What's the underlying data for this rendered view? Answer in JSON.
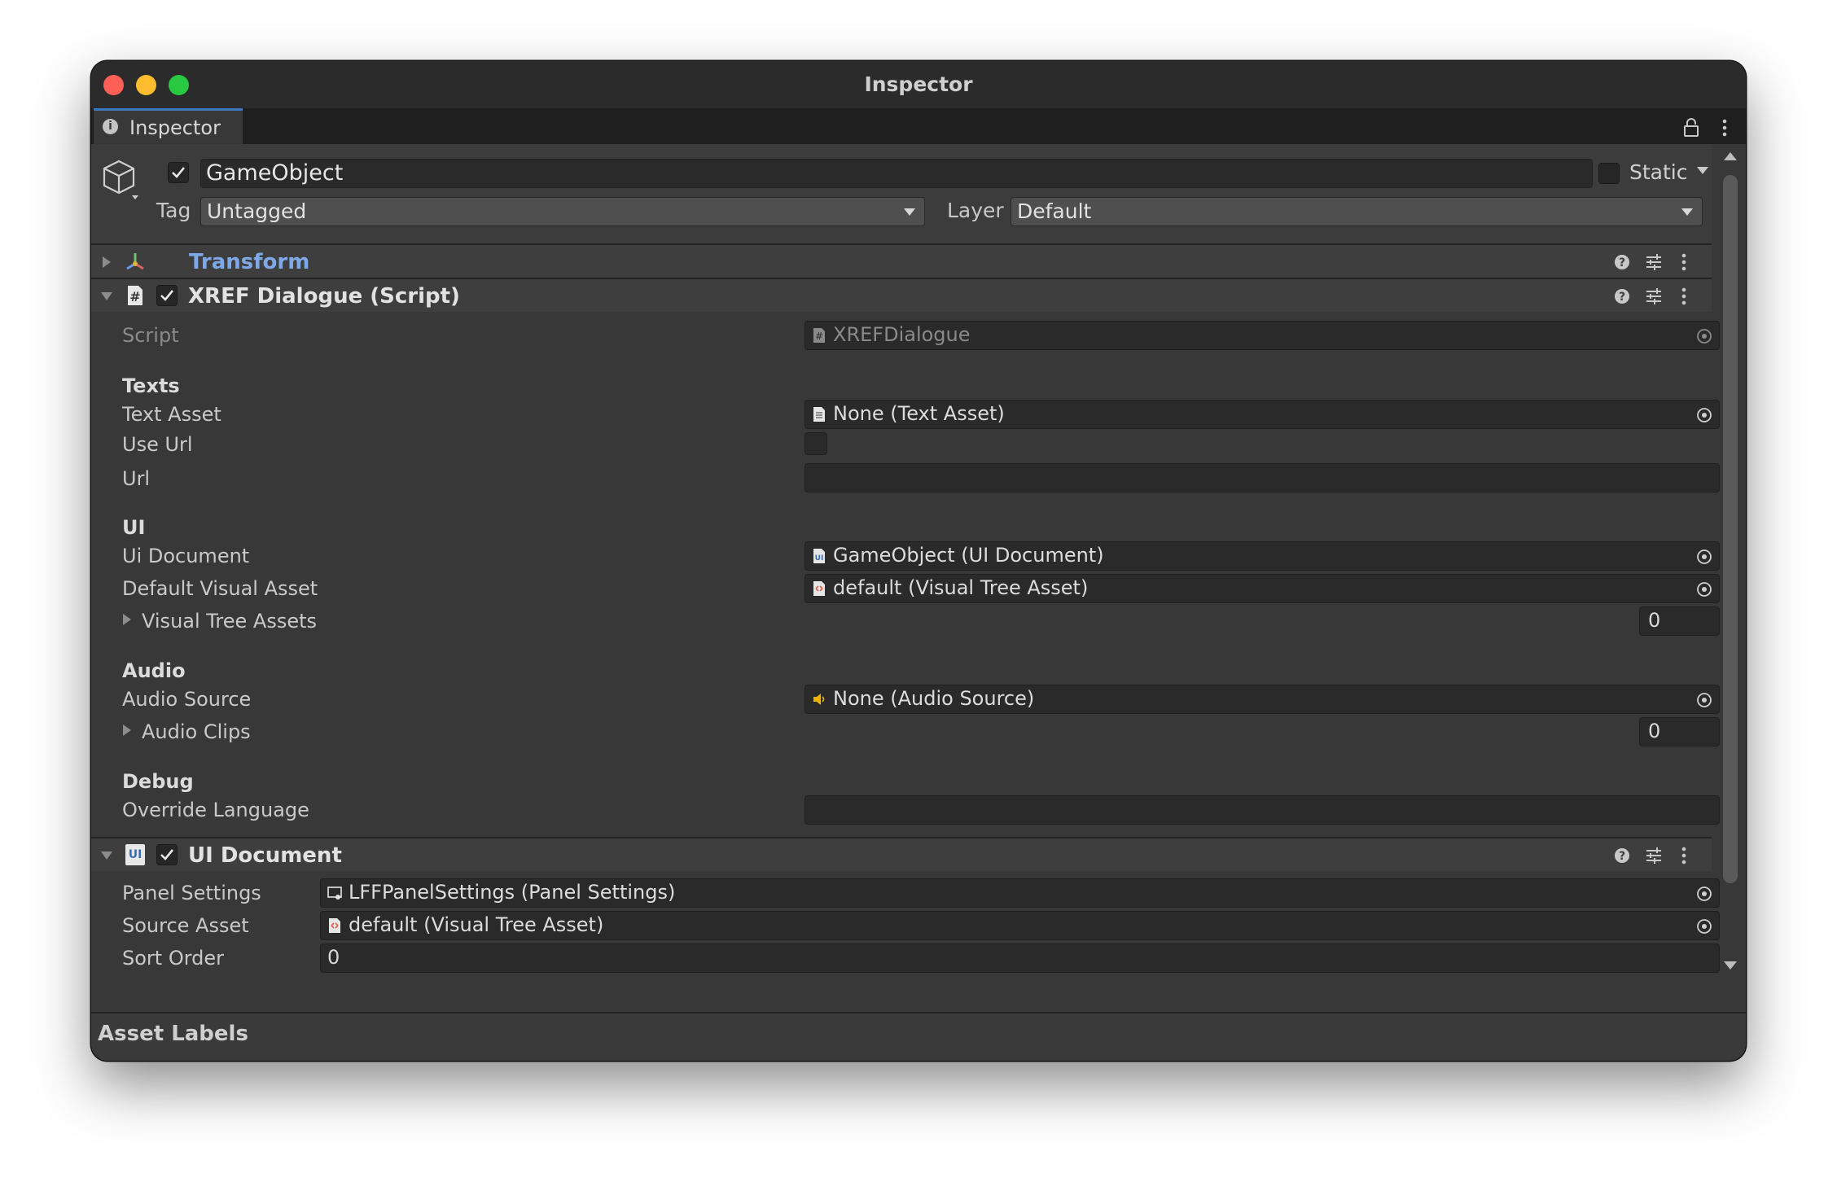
{
  "window": {
    "title": "Inspector"
  },
  "tab": {
    "label": "Inspector"
  },
  "gameobject": {
    "name": "GameObject",
    "static_label": "Static",
    "tag_label": "Tag",
    "tag_value": "Untagged",
    "layer_label": "Layer",
    "layer_value": "Default"
  },
  "transform": {
    "title": "Transform"
  },
  "xref": {
    "title": "XREF Dialogue (Script)",
    "script_label": "Script",
    "script_value": "XREFDialogue",
    "texts_header": "Texts",
    "text_asset_label": "Text Asset",
    "text_asset_value": "None (Text Asset)",
    "use_url_label": "Use Url",
    "url_label": "Url",
    "url_value": "",
    "ui_header": "UI",
    "ui_document_label": "Ui Document",
    "ui_document_value": "GameObject (UI Document)",
    "default_visual_label": "Default Visual Asset",
    "default_visual_value": "default (Visual Tree Asset)",
    "visual_tree_label": "Visual Tree Assets",
    "visual_tree_count": "0",
    "audio_header": "Audio",
    "audio_source_label": "Audio Source",
    "audio_source_value": "None (Audio Source)",
    "audio_clips_label": "Audio Clips",
    "audio_clips_count": "0",
    "debug_header": "Debug",
    "override_language_label": "Override Language",
    "override_language_value": ""
  },
  "ui_document": {
    "title": "UI Document",
    "icon_text": "UI",
    "panel_settings_label": "Panel Settings",
    "panel_settings_value": "LFFPanelSettings (Panel Settings)",
    "source_asset_label": "Source Asset",
    "source_asset_value": "default (Visual Tree Asset)",
    "sort_order_label": "Sort Order",
    "sort_order_value": "0"
  },
  "footer": {
    "asset_labels": "Asset Labels"
  },
  "colors": {
    "accent_blue": "#3a79bb",
    "transform_title": "#7fa8e8",
    "audio_icon": "#f0b400",
    "vta_icon": "#e0604a"
  }
}
